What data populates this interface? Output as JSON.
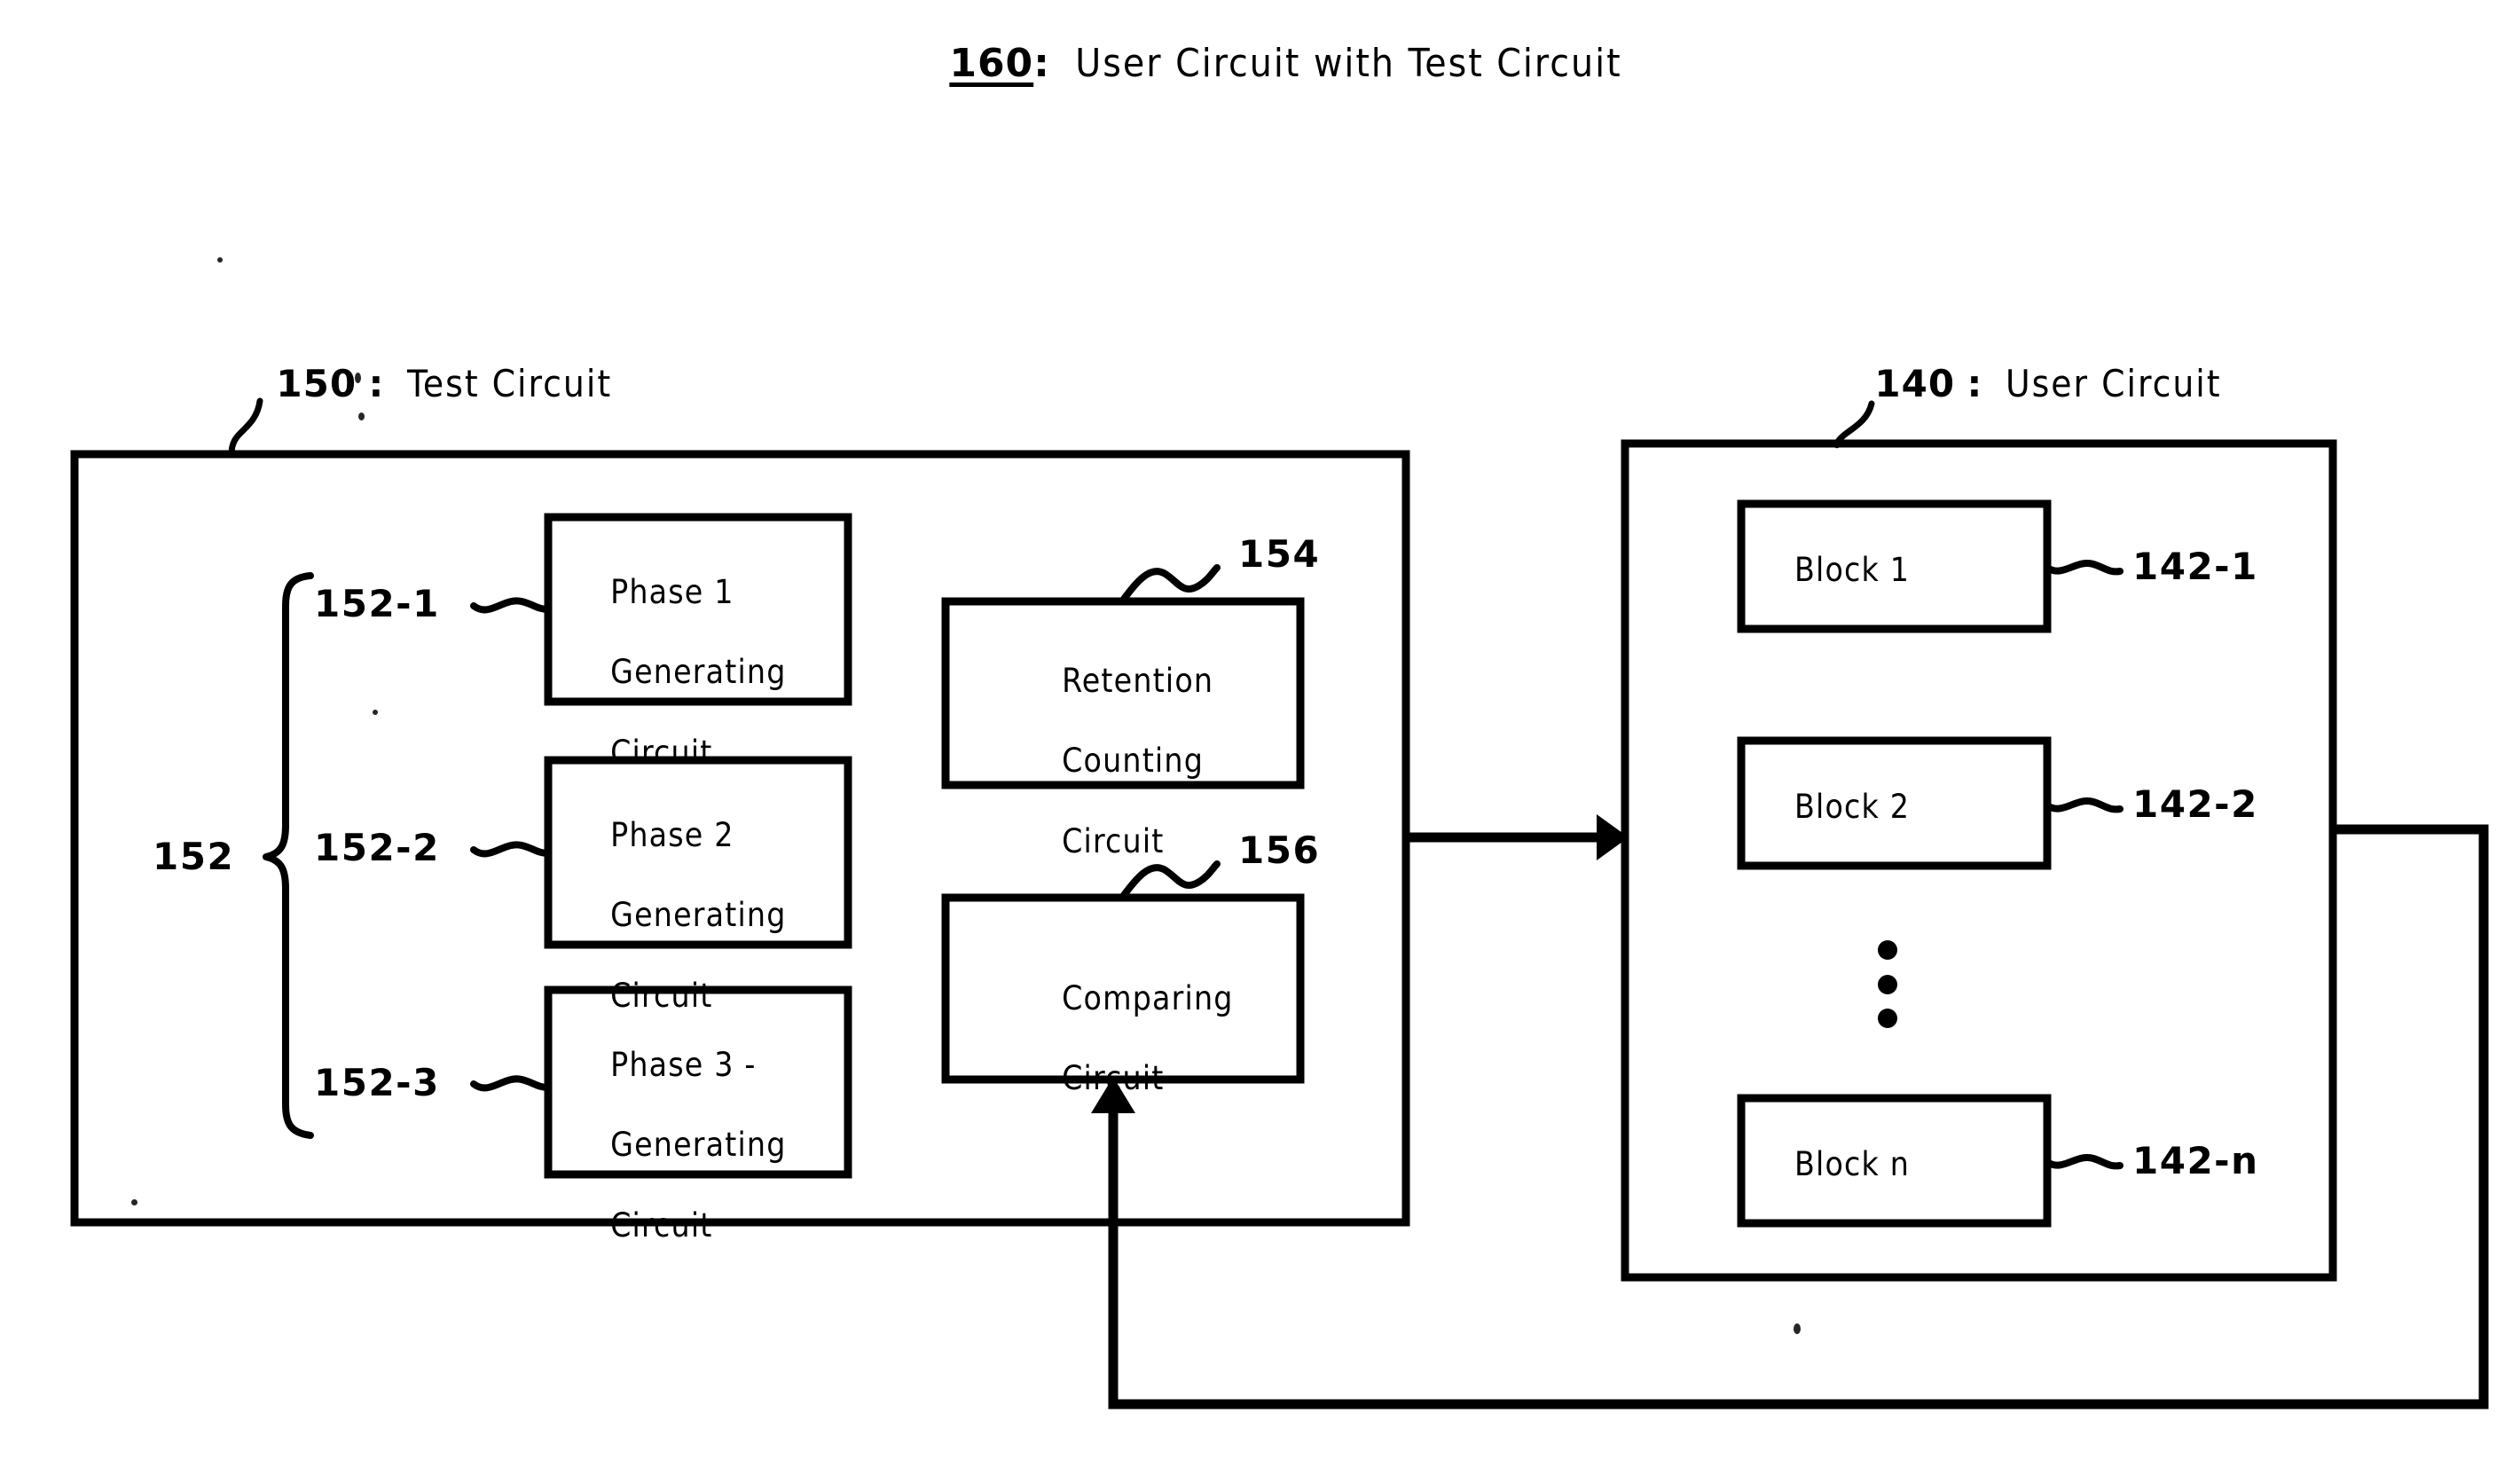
{
  "figure": {
    "title": {
      "number": "160",
      "separator": ":",
      "caption": "User Circuit with Test Circuit"
    },
    "stroke_color": "#000000",
    "background_color": "#ffffff"
  },
  "test_circuit": {
    "header": {
      "number": "150",
      "separator": ":",
      "caption": "Test Circuit"
    },
    "brace_label": "152",
    "generators": [
      {
        "ref": "152-1",
        "label_line1": "Phase 1",
        "label_line2": "Generating",
        "label_line3": "Circuit"
      },
      {
        "ref": "152-2",
        "label_line1": "Phase 2",
        "label_line2": "Generating",
        "label_line3": "Circuit"
      },
      {
        "ref": "152-3",
        "label_line1": "Phase 3 -",
        "label_line2": "Generating",
        "label_line3": "Circuit"
      }
    ],
    "retention_counter": {
      "ref": "154",
      "label_line1": "Retention",
      "label_line2": "Counting",
      "label_line3": "Circuit"
    },
    "comparator": {
      "ref": "156",
      "label_line1": "Comparing",
      "label_line2": "Circuit"
    }
  },
  "user_circuit": {
    "header": {
      "number": "140",
      "separator": ":",
      "caption": "User Circuit"
    },
    "blocks": [
      {
        "ref": "142-1",
        "label": "Block 1"
      },
      {
        "ref": "142-2",
        "label": "Block 2"
      },
      {
        "ref": "142-n",
        "label": "Block n"
      }
    ],
    "ellipsis": "⋮"
  },
  "connections": [
    {
      "name": "test-to-user-arrow",
      "from": "test_circuit",
      "to": "user_circuit",
      "direction": "right"
    },
    {
      "name": "user-feedback-to-comparator",
      "from": "user_circuit",
      "to": "comparator",
      "direction": "up"
    }
  ]
}
